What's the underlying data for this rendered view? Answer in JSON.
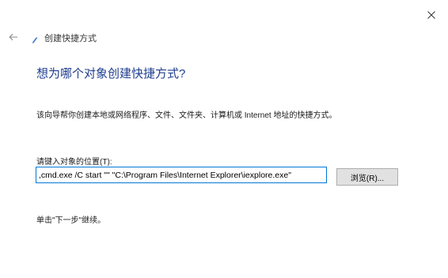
{
  "window": {
    "title": "创建快捷方式"
  },
  "main": {
    "heading": "想为哪个对象创建快捷方式?",
    "description": "该向导帮你创建本地或网络程序、文件、文件夹、计算机或 Internet 地址的快捷方式。",
    "location_label": "请键入对象的位置(T):",
    "location_value": ",cmd.exe /C start \"\" \"C:\\Program Files\\Internet Explorer\\iexplore.exe\"",
    "browse_label": "浏览(R)...",
    "hint": "单击\"下一步\"继续。"
  },
  "icons": {
    "close": "close-icon",
    "back": "back-arrow-icon",
    "app": "shortcut-app-icon"
  },
  "colors": {
    "heading": "#1e3d8f",
    "input_border": "#0078d7",
    "button_bg": "#e1e1e1"
  }
}
